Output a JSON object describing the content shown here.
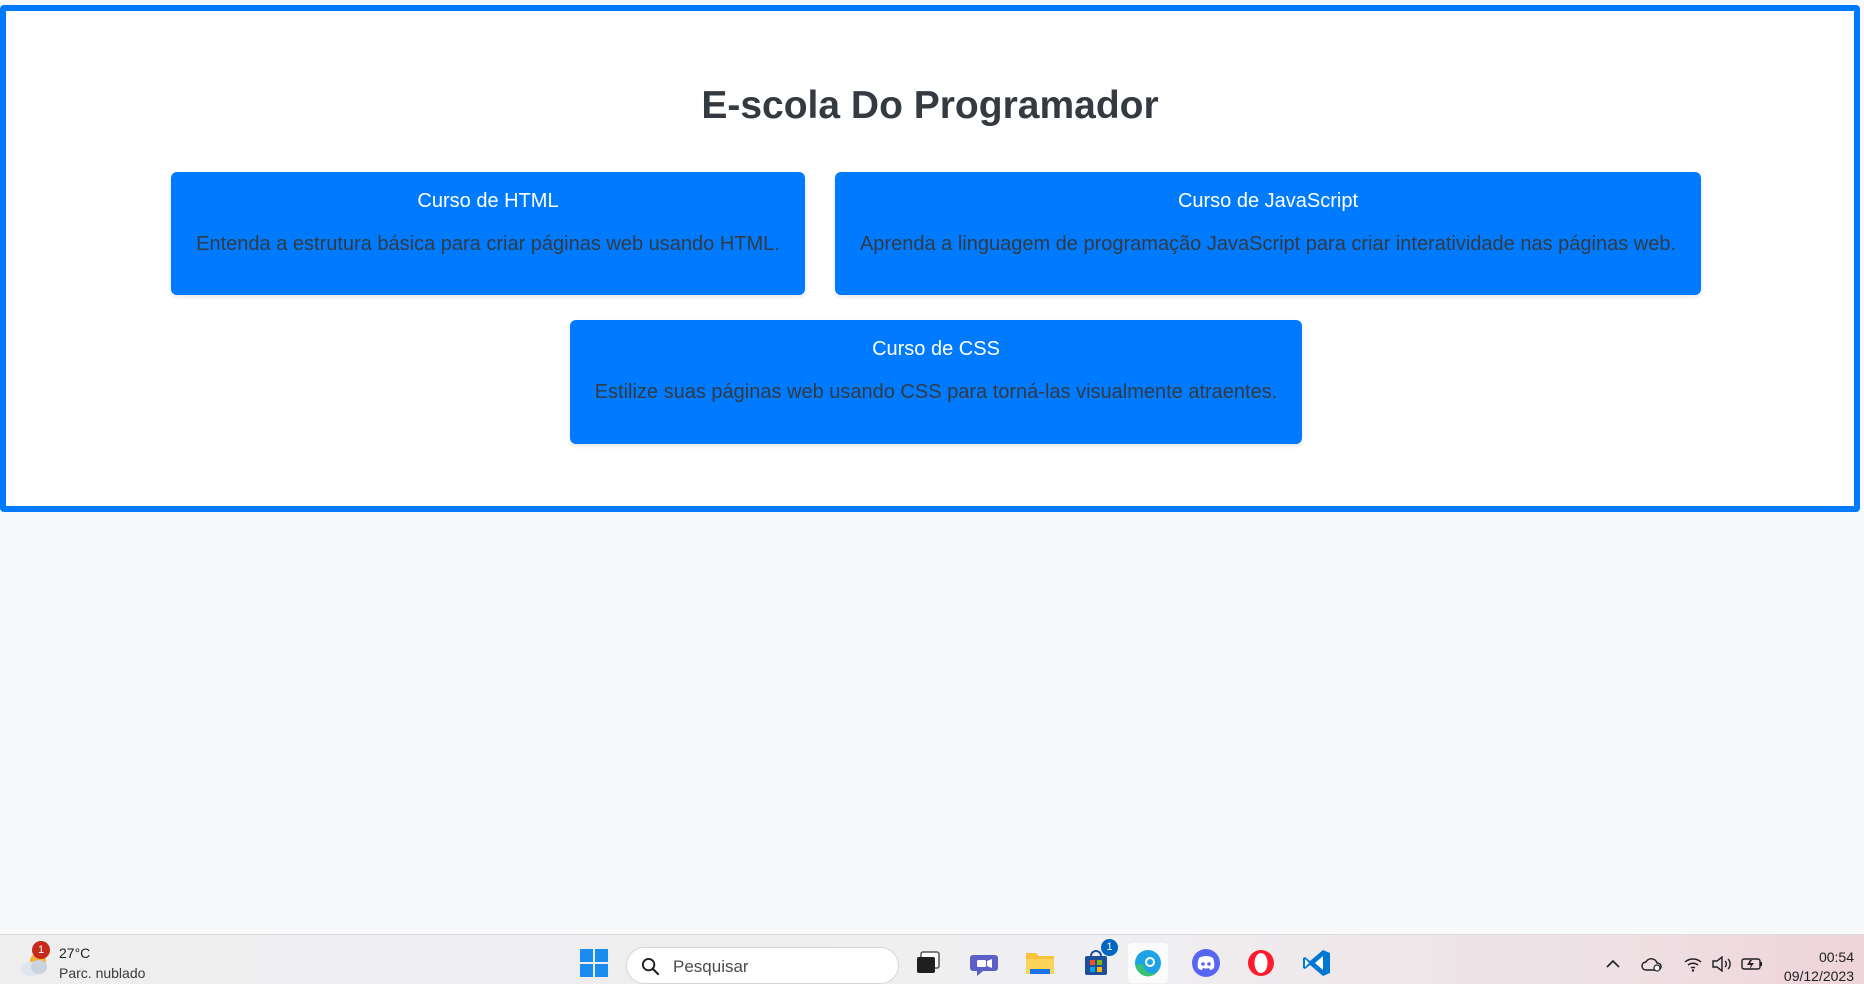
{
  "page": {
    "title": "E-scola Do Programador"
  },
  "courses": [
    {
      "title": "Curso de HTML",
      "description": "Entenda a estrutura básica para criar páginas web usando HTML."
    },
    {
      "title": "Curso de JavaScript",
      "description": "Aprenda a linguagem de programação JavaScript para criar interatividade nas páginas web."
    },
    {
      "title": "Curso de CSS",
      "description": "Estilize suas páginas web usando CSS para torná-las visualmente atraentes."
    }
  ],
  "taskbar": {
    "weather": {
      "temperature": "27°C",
      "condition": "Parc. nublado",
      "badge": "1"
    },
    "search": {
      "placeholder": "Pesquisar"
    },
    "store_badge": "1",
    "clock": {
      "time": "00:54",
      "date": "09/12/2023"
    },
    "apps": [
      "windows-start-icon",
      "task-view-icon",
      "teams-chat-icon",
      "file-explorer-icon",
      "microsoft-store-icon",
      "edge-browser-icon",
      "discord-icon",
      "opera-icon",
      "vscode-icon"
    ],
    "tray": [
      "chevron-up-icon",
      "onedrive-icon",
      "wifi-icon",
      "volume-icon",
      "battery-icon"
    ]
  },
  "colors": {
    "accent": "#007bff",
    "page_background": "#f8f9fa",
    "heading_text": "#343a40",
    "card_title_text": "#ffffff"
  }
}
